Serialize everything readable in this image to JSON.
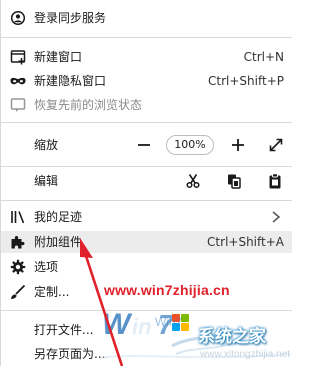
{
  "menu": {
    "sync": {
      "label": "登录同步服务",
      "icon": "account-icon"
    },
    "new_window": {
      "label": "新建窗口",
      "shortcut": "Ctrl+N",
      "icon": "new-window-icon"
    },
    "new_private": {
      "label": "新建隐私窗口",
      "shortcut": "Ctrl+Shift+P",
      "icon": "mask-icon"
    },
    "restore": {
      "label": "恢复先前的浏览状态",
      "icon": "restore-icon",
      "disabled": true
    },
    "zoom": {
      "label": "缩放",
      "value": "100%",
      "minus": "—",
      "plus": "+",
      "fullscreen_icon": "fullscreen-icon"
    },
    "edit": {
      "label": "编辑",
      "cut_icon": "cut-icon",
      "copy_icon": "copy-icon",
      "paste_icon": "paste-icon"
    },
    "library": {
      "label": "我的足迹",
      "icon": "library-icon",
      "chevron": "chevron-right-icon"
    },
    "addons": {
      "label": "附加组件",
      "shortcut": "Ctrl+Shift+A",
      "icon": "puzzle-icon",
      "highlighted": true
    },
    "options": {
      "label": "选项",
      "icon": "gear-icon"
    },
    "customize": {
      "label": "定制...",
      "icon": "brush-icon"
    },
    "open_file": {
      "label": "打开文件..."
    },
    "save_page": {
      "label": "另存页面为..."
    }
  },
  "watermark": {
    "url": "www.win7zhijia.cn",
    "site_name": "系统之家",
    "logo_text": "Win7",
    "sub": "www.xitongzhijia.net",
    "url_color": "#e0202a"
  },
  "annotation": {
    "arrow_color": "#e0202a"
  }
}
